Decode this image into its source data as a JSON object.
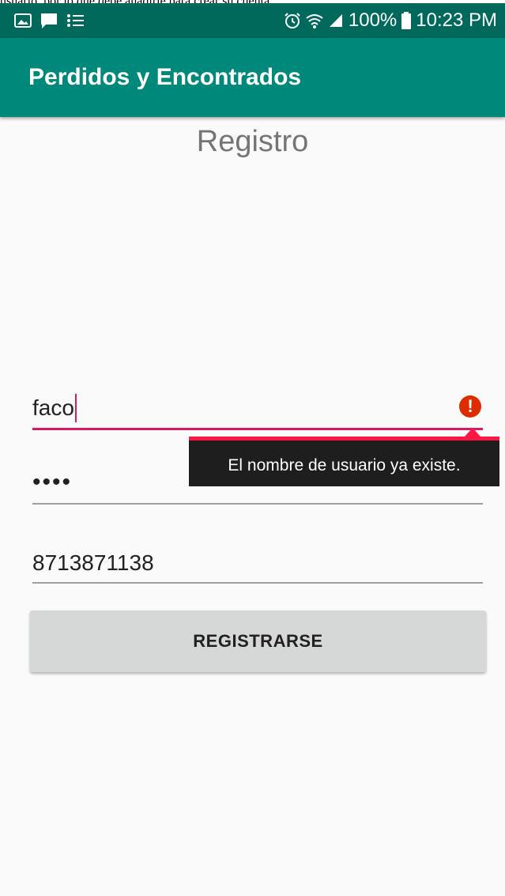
{
  "top_caption": "usuario, por lo que debe anadirle para crear su cuenta.",
  "status_bar": {
    "left_icons": [
      "image-icon",
      "chat-icon",
      "list-icon"
    ],
    "right_icons": [
      "alarm-icon",
      "wifi-icon",
      "signal-icon",
      "battery-icon"
    ],
    "battery": "100%",
    "time": "10:23 PM"
  },
  "app_bar": {
    "title": "Perdidos y Encontrados",
    "color": "#00897b"
  },
  "screen": {
    "title": "Registro"
  },
  "form": {
    "username": {
      "value": "faco",
      "error_tooltip": "El nombre de usuario ya existe."
    },
    "password": {
      "value": "••••"
    },
    "phone": {
      "value": "8713871138"
    },
    "submit_label": "REGISTRARSE"
  },
  "colors": {
    "accent": "#d81b60",
    "error": "#dd2c00",
    "status_bar": "#00695c"
  }
}
